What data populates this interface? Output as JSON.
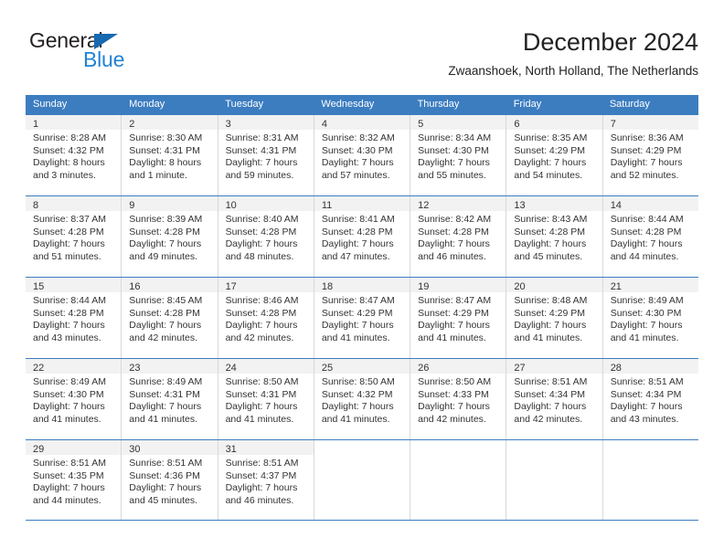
{
  "brand": {
    "name_part1": "General",
    "name_part2": "Blue",
    "triangle_color": "#1769b0",
    "blue_color": "#2183d4"
  },
  "header": {
    "title": "December 2024",
    "subtitle": "Zwaanshoek, North Holland, The Netherlands"
  },
  "calendar": {
    "header_bg": "#3c7dc0",
    "daynum_bg": "#f2f2f2",
    "weekdays": [
      "Sunday",
      "Monday",
      "Tuesday",
      "Wednesday",
      "Thursday",
      "Friday",
      "Saturday"
    ],
    "weeks": [
      [
        {
          "day": "1",
          "sunrise": "Sunrise: 8:28 AM",
          "sunset": "Sunset: 4:32 PM",
          "daylight_line1": "Daylight: 8 hours",
          "daylight_line2": "and 3 minutes."
        },
        {
          "day": "2",
          "sunrise": "Sunrise: 8:30 AM",
          "sunset": "Sunset: 4:31 PM",
          "daylight_line1": "Daylight: 8 hours",
          "daylight_line2": "and 1 minute."
        },
        {
          "day": "3",
          "sunrise": "Sunrise: 8:31 AM",
          "sunset": "Sunset: 4:31 PM",
          "daylight_line1": "Daylight: 7 hours",
          "daylight_line2": "and 59 minutes."
        },
        {
          "day": "4",
          "sunrise": "Sunrise: 8:32 AM",
          "sunset": "Sunset: 4:30 PM",
          "daylight_line1": "Daylight: 7 hours",
          "daylight_line2": "and 57 minutes."
        },
        {
          "day": "5",
          "sunrise": "Sunrise: 8:34 AM",
          "sunset": "Sunset: 4:30 PM",
          "daylight_line1": "Daylight: 7 hours",
          "daylight_line2": "and 55 minutes."
        },
        {
          "day": "6",
          "sunrise": "Sunrise: 8:35 AM",
          "sunset": "Sunset: 4:29 PM",
          "daylight_line1": "Daylight: 7 hours",
          "daylight_line2": "and 54 minutes."
        },
        {
          "day": "7",
          "sunrise": "Sunrise: 8:36 AM",
          "sunset": "Sunset: 4:29 PM",
          "daylight_line1": "Daylight: 7 hours",
          "daylight_line2": "and 52 minutes."
        }
      ],
      [
        {
          "day": "8",
          "sunrise": "Sunrise: 8:37 AM",
          "sunset": "Sunset: 4:28 PM",
          "daylight_line1": "Daylight: 7 hours",
          "daylight_line2": "and 51 minutes."
        },
        {
          "day": "9",
          "sunrise": "Sunrise: 8:39 AM",
          "sunset": "Sunset: 4:28 PM",
          "daylight_line1": "Daylight: 7 hours",
          "daylight_line2": "and 49 minutes."
        },
        {
          "day": "10",
          "sunrise": "Sunrise: 8:40 AM",
          "sunset": "Sunset: 4:28 PM",
          "daylight_line1": "Daylight: 7 hours",
          "daylight_line2": "and 48 minutes."
        },
        {
          "day": "11",
          "sunrise": "Sunrise: 8:41 AM",
          "sunset": "Sunset: 4:28 PM",
          "daylight_line1": "Daylight: 7 hours",
          "daylight_line2": "and 47 minutes."
        },
        {
          "day": "12",
          "sunrise": "Sunrise: 8:42 AM",
          "sunset": "Sunset: 4:28 PM",
          "daylight_line1": "Daylight: 7 hours",
          "daylight_line2": "and 46 minutes."
        },
        {
          "day": "13",
          "sunrise": "Sunrise: 8:43 AM",
          "sunset": "Sunset: 4:28 PM",
          "daylight_line1": "Daylight: 7 hours",
          "daylight_line2": "and 45 minutes."
        },
        {
          "day": "14",
          "sunrise": "Sunrise: 8:44 AM",
          "sunset": "Sunset: 4:28 PM",
          "daylight_line1": "Daylight: 7 hours",
          "daylight_line2": "and 44 minutes."
        }
      ],
      [
        {
          "day": "15",
          "sunrise": "Sunrise: 8:44 AM",
          "sunset": "Sunset: 4:28 PM",
          "daylight_line1": "Daylight: 7 hours",
          "daylight_line2": "and 43 minutes."
        },
        {
          "day": "16",
          "sunrise": "Sunrise: 8:45 AM",
          "sunset": "Sunset: 4:28 PM",
          "daylight_line1": "Daylight: 7 hours",
          "daylight_line2": "and 42 minutes."
        },
        {
          "day": "17",
          "sunrise": "Sunrise: 8:46 AM",
          "sunset": "Sunset: 4:28 PM",
          "daylight_line1": "Daylight: 7 hours",
          "daylight_line2": "and 42 minutes."
        },
        {
          "day": "18",
          "sunrise": "Sunrise: 8:47 AM",
          "sunset": "Sunset: 4:29 PM",
          "daylight_line1": "Daylight: 7 hours",
          "daylight_line2": "and 41 minutes."
        },
        {
          "day": "19",
          "sunrise": "Sunrise: 8:47 AM",
          "sunset": "Sunset: 4:29 PM",
          "daylight_line1": "Daylight: 7 hours",
          "daylight_line2": "and 41 minutes."
        },
        {
          "day": "20",
          "sunrise": "Sunrise: 8:48 AM",
          "sunset": "Sunset: 4:29 PM",
          "daylight_line1": "Daylight: 7 hours",
          "daylight_line2": "and 41 minutes."
        },
        {
          "day": "21",
          "sunrise": "Sunrise: 8:49 AM",
          "sunset": "Sunset: 4:30 PM",
          "daylight_line1": "Daylight: 7 hours",
          "daylight_line2": "and 41 minutes."
        }
      ],
      [
        {
          "day": "22",
          "sunrise": "Sunrise: 8:49 AM",
          "sunset": "Sunset: 4:30 PM",
          "daylight_line1": "Daylight: 7 hours",
          "daylight_line2": "and 41 minutes."
        },
        {
          "day": "23",
          "sunrise": "Sunrise: 8:49 AM",
          "sunset": "Sunset: 4:31 PM",
          "daylight_line1": "Daylight: 7 hours",
          "daylight_line2": "and 41 minutes."
        },
        {
          "day": "24",
          "sunrise": "Sunrise: 8:50 AM",
          "sunset": "Sunset: 4:31 PM",
          "daylight_line1": "Daylight: 7 hours",
          "daylight_line2": "and 41 minutes."
        },
        {
          "day": "25",
          "sunrise": "Sunrise: 8:50 AM",
          "sunset": "Sunset: 4:32 PM",
          "daylight_line1": "Daylight: 7 hours",
          "daylight_line2": "and 41 minutes."
        },
        {
          "day": "26",
          "sunrise": "Sunrise: 8:50 AM",
          "sunset": "Sunset: 4:33 PM",
          "daylight_line1": "Daylight: 7 hours",
          "daylight_line2": "and 42 minutes."
        },
        {
          "day": "27",
          "sunrise": "Sunrise: 8:51 AM",
          "sunset": "Sunset: 4:34 PM",
          "daylight_line1": "Daylight: 7 hours",
          "daylight_line2": "and 42 minutes."
        },
        {
          "day": "28",
          "sunrise": "Sunrise: 8:51 AM",
          "sunset": "Sunset: 4:34 PM",
          "daylight_line1": "Daylight: 7 hours",
          "daylight_line2": "and 43 minutes."
        }
      ],
      [
        {
          "day": "29",
          "sunrise": "Sunrise: 8:51 AM",
          "sunset": "Sunset: 4:35 PM",
          "daylight_line1": "Daylight: 7 hours",
          "daylight_line2": "and 44 minutes."
        },
        {
          "day": "30",
          "sunrise": "Sunrise: 8:51 AM",
          "sunset": "Sunset: 4:36 PM",
          "daylight_line1": "Daylight: 7 hours",
          "daylight_line2": "and 45 minutes."
        },
        {
          "day": "31",
          "sunrise": "Sunrise: 8:51 AM",
          "sunset": "Sunset: 4:37 PM",
          "daylight_line1": "Daylight: 7 hours",
          "daylight_line2": "and 46 minutes."
        },
        {
          "day": "",
          "sunrise": "",
          "sunset": "",
          "daylight_line1": "",
          "daylight_line2": ""
        },
        {
          "day": "",
          "sunrise": "",
          "sunset": "",
          "daylight_line1": "",
          "daylight_line2": ""
        },
        {
          "day": "",
          "sunrise": "",
          "sunset": "",
          "daylight_line1": "",
          "daylight_line2": ""
        },
        {
          "day": "",
          "sunrise": "",
          "sunset": "",
          "daylight_line1": "",
          "daylight_line2": ""
        }
      ]
    ]
  }
}
